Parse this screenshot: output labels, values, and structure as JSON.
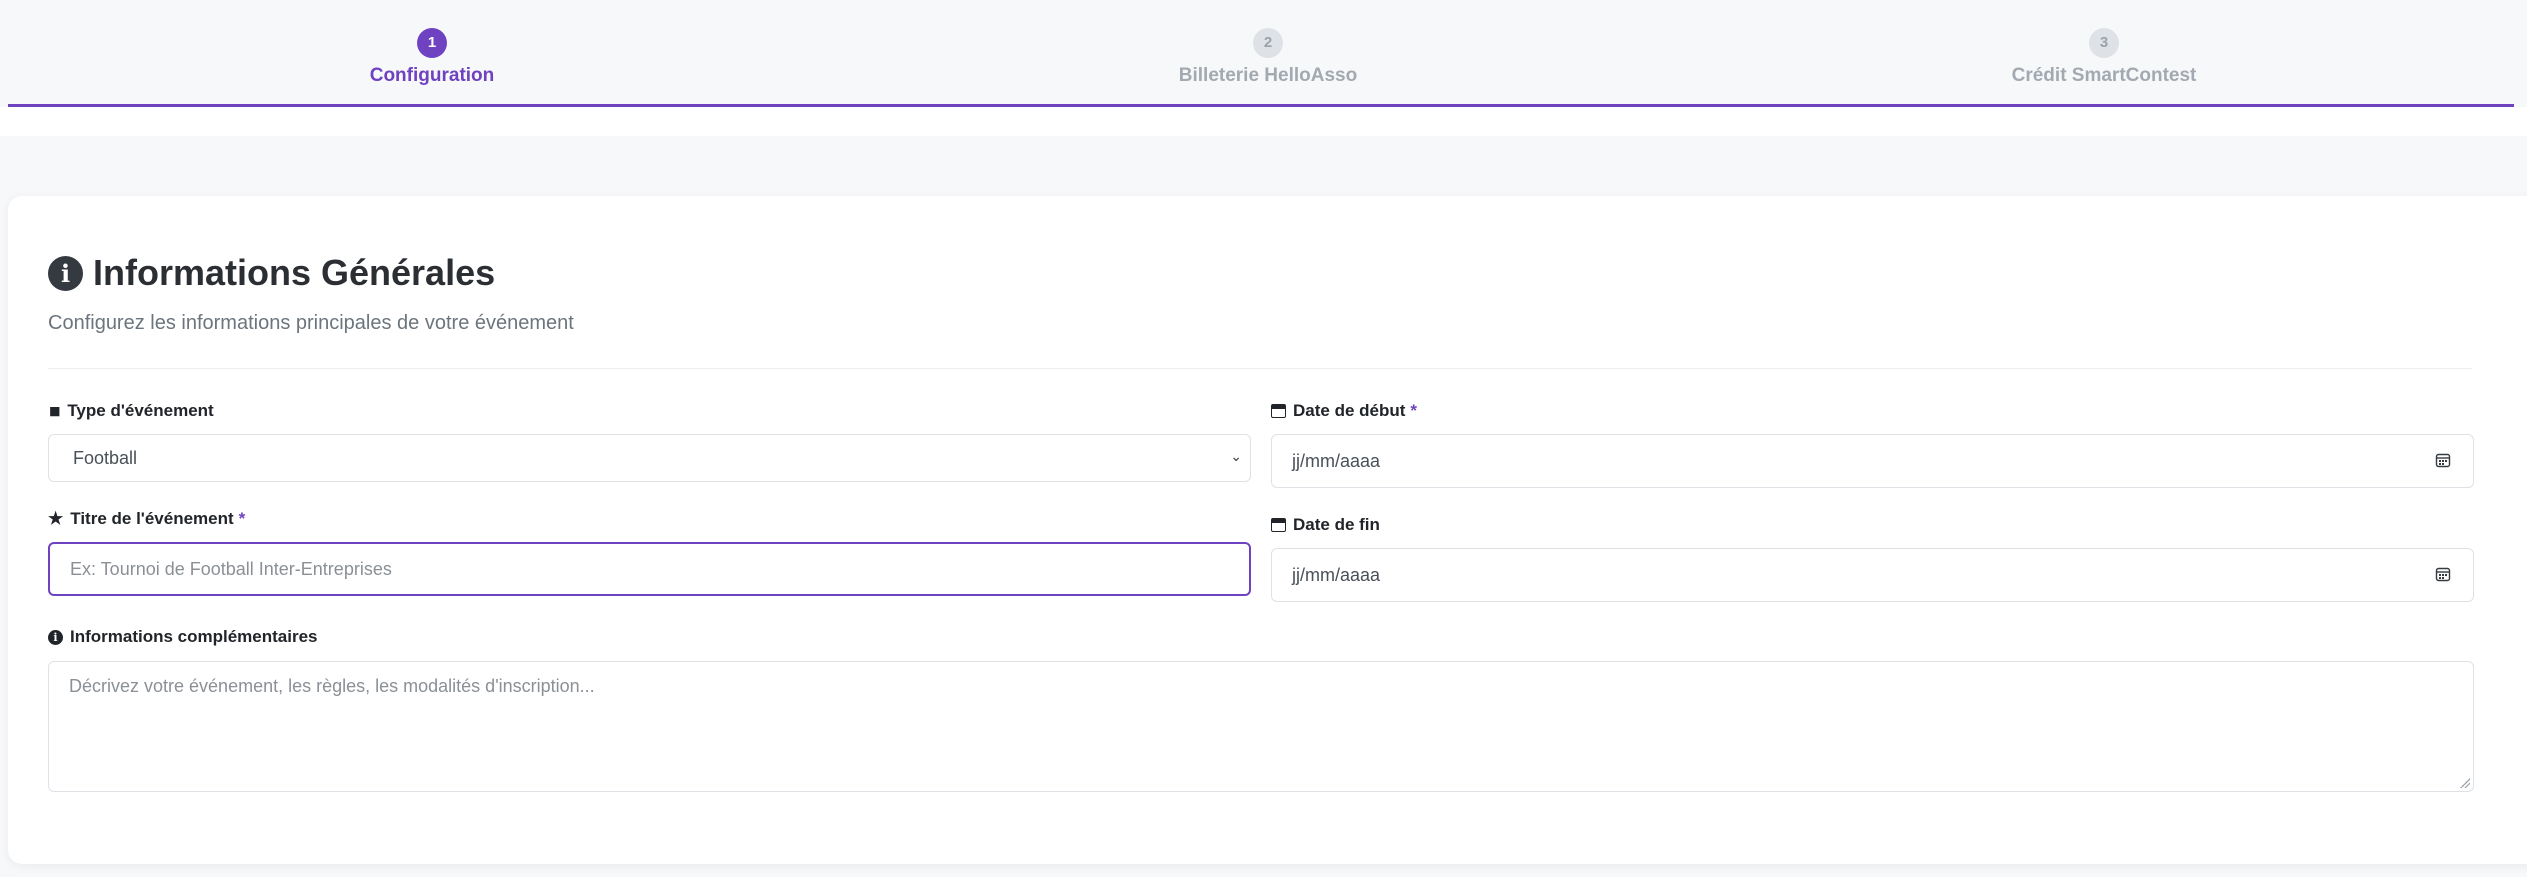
{
  "stepper": {
    "steps": [
      {
        "number": "1",
        "label": "Configuration",
        "state": "active"
      },
      {
        "number": "2",
        "label": "Billeterie HelloAsso",
        "state": "inactive"
      },
      {
        "number": "3",
        "label": "Crédit SmartContest",
        "state": "inactive"
      }
    ]
  },
  "card": {
    "title": "Informations Générales",
    "subtitle": "Configurez les informations principales de votre événement",
    "icon": "info-circle-icon"
  },
  "form": {
    "event_type": {
      "label": "Type d'événement",
      "value": "Football",
      "icon": "tag-icon"
    },
    "event_title": {
      "label": "Titre de l'événement",
      "required_mark": "*",
      "placeholder": "Ex: Tournoi de Football Inter-Entreprises",
      "icon": "star-icon"
    },
    "start_date": {
      "label": "Date de début",
      "required_mark": "*",
      "placeholder": "jj/mm/aaaa",
      "icon": "calendar-icon"
    },
    "end_date": {
      "label": "Date de fin",
      "placeholder": "jj/mm/aaaa",
      "icon": "calendar-icon"
    },
    "additional_info": {
      "label": "Informations complémentaires",
      "placeholder": "Décrivez votre événement, les règles, les modalités d'inscription...",
      "icon": "info-circle-icon"
    }
  },
  "colors": {
    "accent": "#6f42c1",
    "inactive": "#dee2e6"
  }
}
